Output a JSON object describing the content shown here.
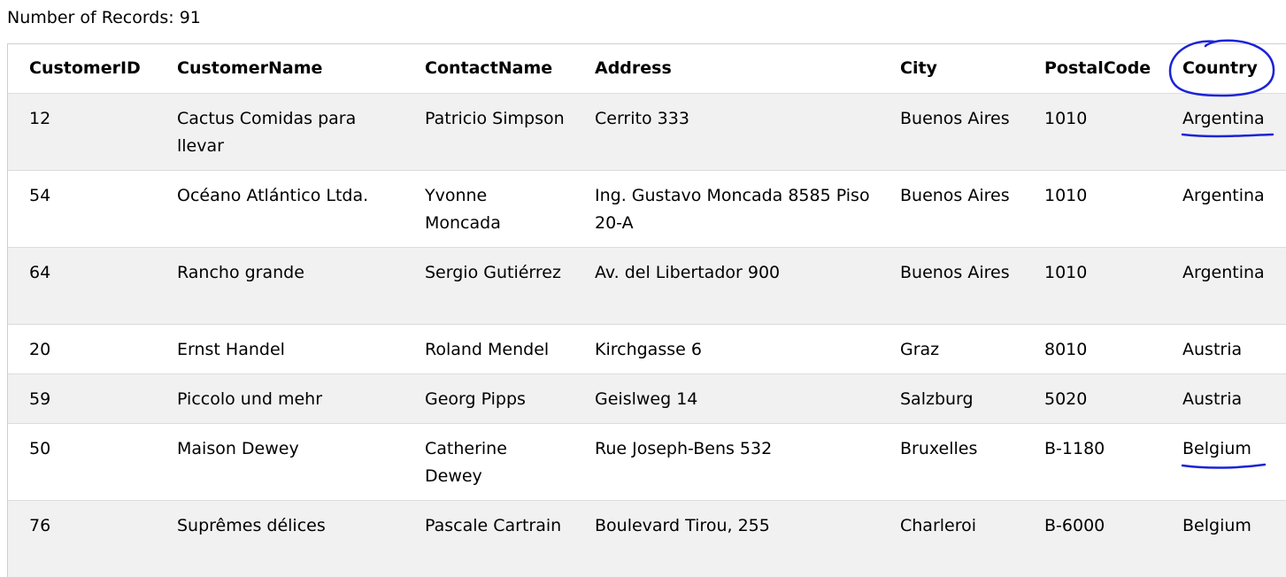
{
  "records_label": "Number of Records: 91",
  "table": {
    "headers": [
      "CustomerID",
      "CustomerName",
      "ContactName",
      "Address",
      "City",
      "PostalCode",
      "Country"
    ],
    "rows": [
      [
        "12",
        "Cactus Comidas para llevar",
        "Patricio Simpson",
        "Cerrito 333",
        "Buenos Aires",
        "1010",
        "Argentina"
      ],
      [
        "54",
        "Océano Atlántico Ltda.",
        "Yvonne Moncada",
        "Ing. Gustavo Moncada 8585 Piso 20-A",
        "Buenos Aires",
        "1010",
        "Argentina"
      ],
      [
        "64",
        "Rancho grande",
        "Sergio Gutiérrez",
        "Av. del Libertador 900",
        "Buenos Aires",
        "1010",
        "Argentina"
      ],
      [
        "20",
        "Ernst Handel",
        "Roland Mendel",
        "Kirchgasse 6",
        "Graz",
        "8010",
        "Austria"
      ],
      [
        "59",
        "Piccolo und mehr",
        "Georg Pipps",
        "Geislweg 14",
        "Salzburg",
        "5020",
        "Austria"
      ],
      [
        "50",
        "Maison Dewey",
        "Catherine Dewey",
        "Rue Joseph-Bens 532",
        "Bruxelles",
        "B-1180",
        "Belgium"
      ],
      [
        "76",
        "Suprêmes délices",
        "Pascale Cartrain",
        "Boulevard Tirou, 255",
        "Charleroi",
        "B-6000",
        "Belgium"
      ]
    ]
  },
  "colors": {
    "annotation_ink": "#1a23d6",
    "stripe": "#f1f1f1"
  }
}
